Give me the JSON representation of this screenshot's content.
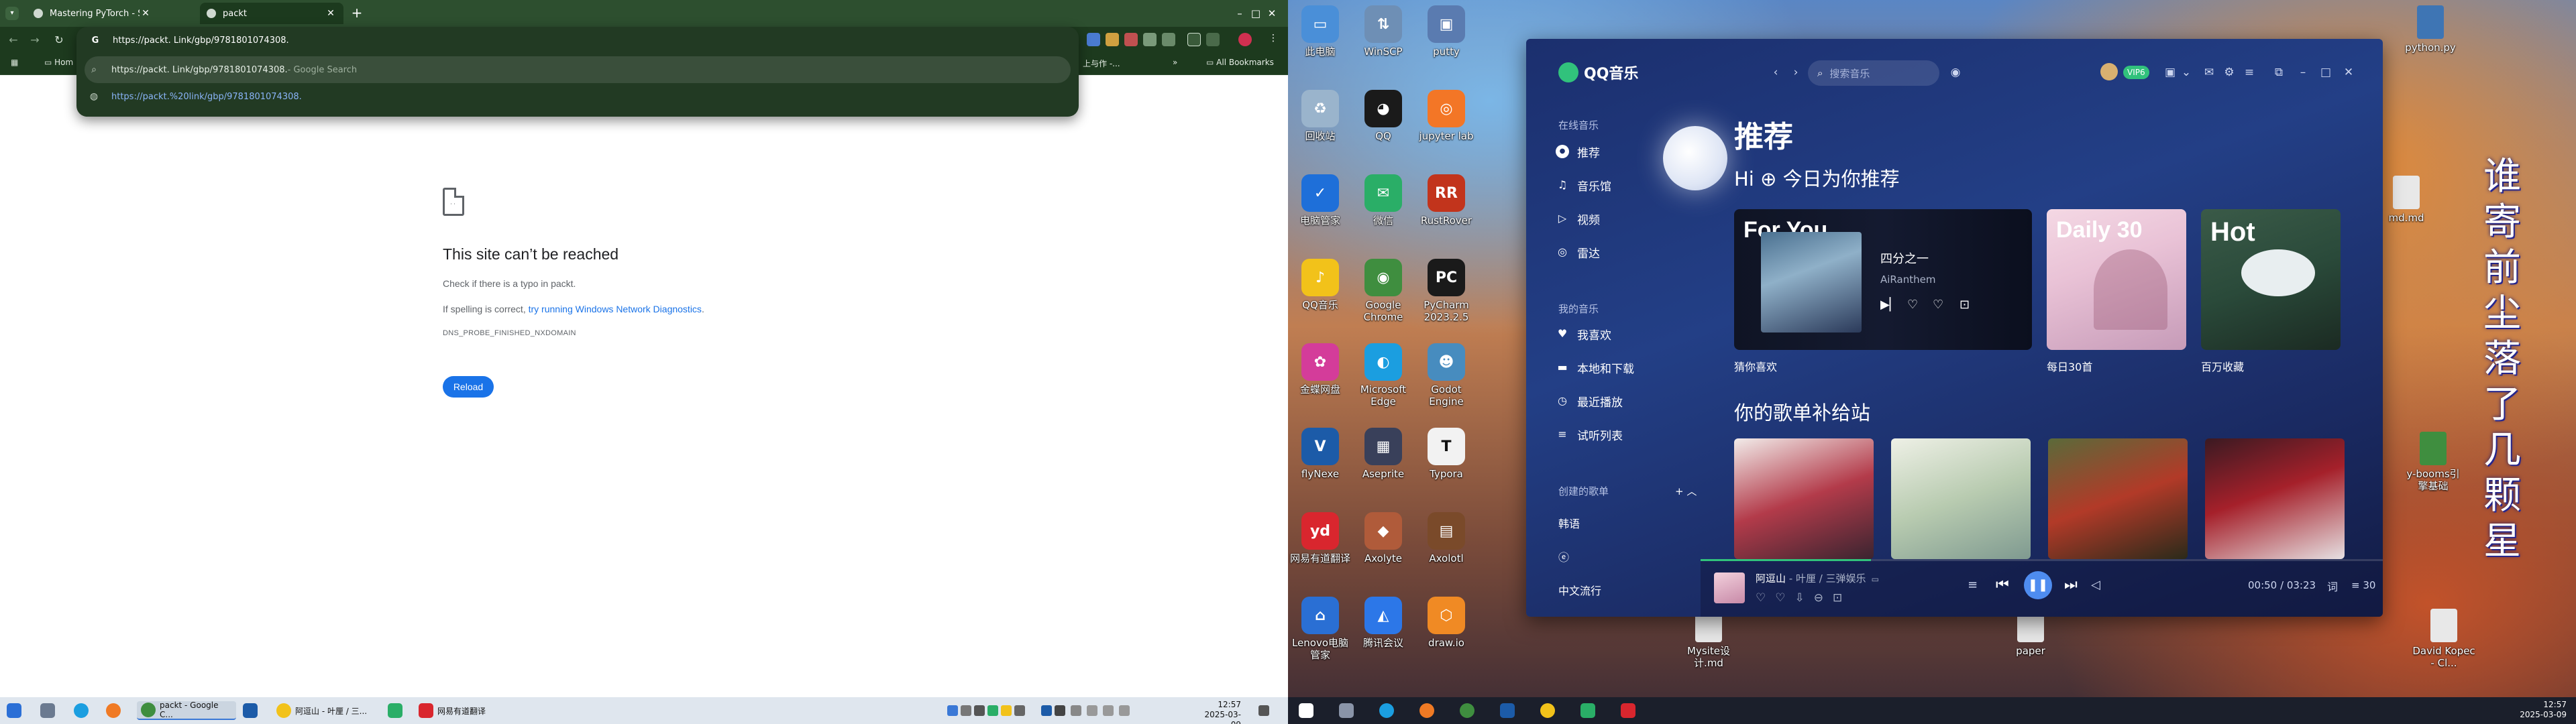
{
  "left_screen": {
    "browser": {
      "tabs": [
        {
          "label": "Mastering PyTorch - Second"
        },
        {
          "label": "packt"
        }
      ],
      "new_tab": "+",
      "window_controls": {
        "minimize": "–",
        "maximize": "□",
        "close": "✕"
      },
      "address": "https://packt. Link/gbp/9781801074308.",
      "suggestions": [
        {
          "text": "https://packt. Link/gbp/9781801074308.",
          "suffix": " - Google Search"
        },
        {
          "text": "https://packt.%20link/gbp/9781801074308."
        }
      ],
      "bookmarks": {
        "left": "Hom",
        "right_partial": "上与作 -...",
        "more": "»",
        "all": "All Bookmarks"
      }
    },
    "error_page": {
      "title": "This site can’t be reached",
      "line1": "Check if there is a typo in packt.",
      "line2_prefix": "If spelling is correct, ",
      "line2_link": "try running Windows Network Diagnostics",
      "line2_suffix": ".",
      "code": "DNS_PROBE_FINISHED_NXDOMAIN",
      "reload": "Reload"
    },
    "taskbar": {
      "items": [
        {
          "label": "packt - Google C..."
        },
        {
          "label": "阿逗山 - 叶厘 / 三..."
        },
        {
          "label": "网易有道翻译"
        }
      ],
      "time": "12:57",
      "date": "2025-03-09"
    }
  },
  "right_screen": {
    "desktop_icons": [
      {
        "label": "此电脑",
        "color": "#4a8fd8",
        "glyph": "▭"
      },
      {
        "label": "WinSCP",
        "color": "#6e8fb5",
        "glyph": "⇅"
      },
      {
        "label": "putty",
        "color": "#5a7bb0",
        "glyph": "▣"
      },
      {
        "label": "回收站",
        "color": "#9ab4cc",
        "glyph": "♻"
      },
      {
        "label": "QQ",
        "color": "#1a1a1a",
        "glyph": "◕"
      },
      {
        "label": "jupyter lab",
        "color": "#f37626",
        "glyph": "◎"
      },
      {
        "label": "电脑管家",
        "color": "#1e6fd9",
        "glyph": "✓"
      },
      {
        "label": "微信",
        "color": "#2aae67",
        "glyph": "✉"
      },
      {
        "label": "RustRover",
        "color": "#c2341c",
        "glyph": "RR"
      },
      {
        "label": "QQ音乐",
        "color": "#f2c21a",
        "glyph": "♪"
      },
      {
        "label": "Google Chrome",
        "color": "#3f8e3f",
        "glyph": "◉"
      },
      {
        "label": "PyCharm 2023.2.5",
        "color": "#1a1a1a",
        "glyph": "PC"
      },
      {
        "label": "金蝶网盘",
        "color": "#d43c9a",
        "glyph": "✿"
      },
      {
        "label": "Microsoft Edge",
        "color": "#1b9ee0",
        "glyph": "◐"
      },
      {
        "label": "Godot Engine",
        "color": "#478cbf",
        "glyph": "☻"
      },
      {
        "label": "flyNexe",
        "color": "#1c5ba8",
        "glyph": "V"
      },
      {
        "label": "Aseprite",
        "color": "#39405a",
        "glyph": "▦"
      },
      {
        "label": "Typora",
        "color": "#f2f2f2",
        "glyph": "T"
      },
      {
        "label": "网易有道翻译",
        "color": "#d9262e",
        "glyph": "yd"
      },
      {
        "label": "Axolyte",
        "color": "#b05b3a",
        "glyph": "◆"
      },
      {
        "label": "Axolotl",
        "color": "#7a4a2a",
        "glyph": "▤"
      },
      {
        "label": "Lenovo电脑管家",
        "color": "#2a6fd4",
        "glyph": "⌂"
      },
      {
        "label": "腾讯会议",
        "color": "#2c77e8",
        "glyph": "◭"
      },
      {
        "label": "draw.io",
        "color": "#f08a24",
        "glyph": "⬡"
      }
    ],
    "extra_icons": [
      {
        "label": "python.py",
        "color": "#3e75b4"
      },
      {
        "label": "md.md",
        "color": "#e8e8e8"
      },
      {
        "label": "Mysite设计.md",
        "color": "#e8e8e8"
      },
      {
        "label": "paper",
        "color": "#e8e8e8"
      },
      {
        "label": "David Kopec - Cl...",
        "color": "#e8e8e8"
      },
      {
        "label": "y-booms引擎基础",
        "color": "#3f8e3f"
      }
    ],
    "poem": "谁寄前尘落了几颗星",
    "qq_music": {
      "logo": "QQ音乐",
      "online_section": "在线音乐",
      "nav": [
        "推荐",
        "音乐馆",
        "视频",
        "雷达"
      ],
      "my_section": "我的音乐",
      "my_items": [
        "我喜欢",
        "本地和下载",
        "最近播放",
        "试听列表"
      ],
      "created_section": "创建的歌单",
      "playlists": [
        "韩语",
        "ⓔ",
        "中文流行"
      ],
      "search_placeholder": "搜索音乐",
      "vip": "VIP6",
      "title": "推荐",
      "greeting": "Hi ⊕ 今日为你推荐",
      "for_you": {
        "tag": "For You",
        "song": "四分之一",
        "artist": "AiRanthem"
      },
      "card_labels": [
        "猜你喜欢",
        "每日30首",
        "百万收藏"
      ],
      "daily": "Daily 30",
      "hot": "Hot",
      "section2": "你的歌单补给站",
      "player": {
        "song": "阿逗山",
        "artist": "叶厘 / 三弹娱乐",
        "elapsed": "00:50",
        "total": "03:23",
        "queue": "30",
        "progress": 0.25
      }
    },
    "taskbar": {
      "time": "12:57",
      "date": "2025-03-09"
    }
  }
}
